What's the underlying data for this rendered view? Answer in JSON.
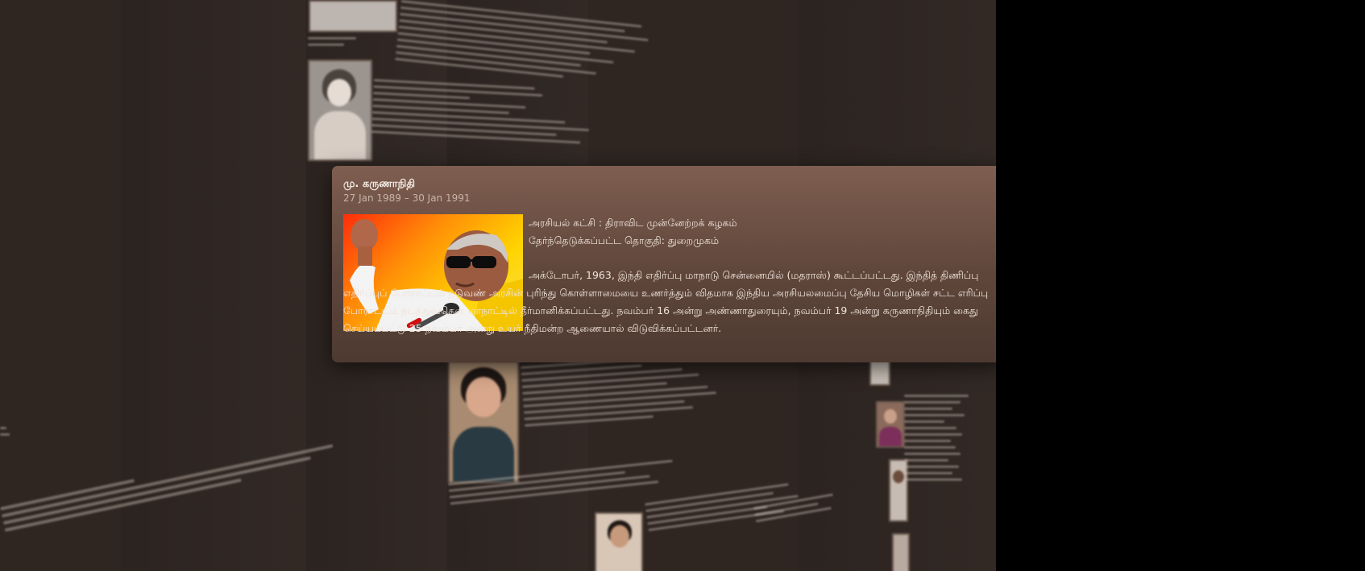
{
  "popup": {
    "name": "மு. கருணாநிதி",
    "dates": "27 Jan 1989 – 30 Jan 1991",
    "party_line": "அரசியல் கட்சி : திராவிட முன்னேற்றக் கழகம்",
    "constituency_line": "தேர்ந்தெடுக்கப்பட்ட தொகுதி: துறைமுகம்",
    "description": "அக்டோபர், 1963, இந்தி எதிர்ப்பு மாநாடு சென்னையில் (மதராஸ்) கூட்டப்பட்டது. இந்தித் திணிப்பு எதிர்ப்புப் போராட்டம் நடுவண் அரசின் புரிந்து கொள்ளாமையை உணர்த்தும் விதமாக இந்திய அரசியலமைப்பு தேசிய மொழிகள் சட்ட எரிப்பு போராட்டம் நடத்துவதென மாநாட்டில் தீர்மானிக்கப்பட்டது. நவம்பர் 16 அன்று அண்ணாதுரையும், நவம்பர் 19 அன்று கருணாநிதியும் கைது செய்யப்பட்டு 25 நவம்பர் அன்று உயர் நீதிமன்ற ஆணையால் விடுவிக்கப்பட்டனர்.",
    "photo_icon": "portrait-photo"
  },
  "colors": {
    "background": "#2f2622",
    "outer": "#000000",
    "card_top": "#7e5e50",
    "card_bottom": "#4d3a31"
  }
}
